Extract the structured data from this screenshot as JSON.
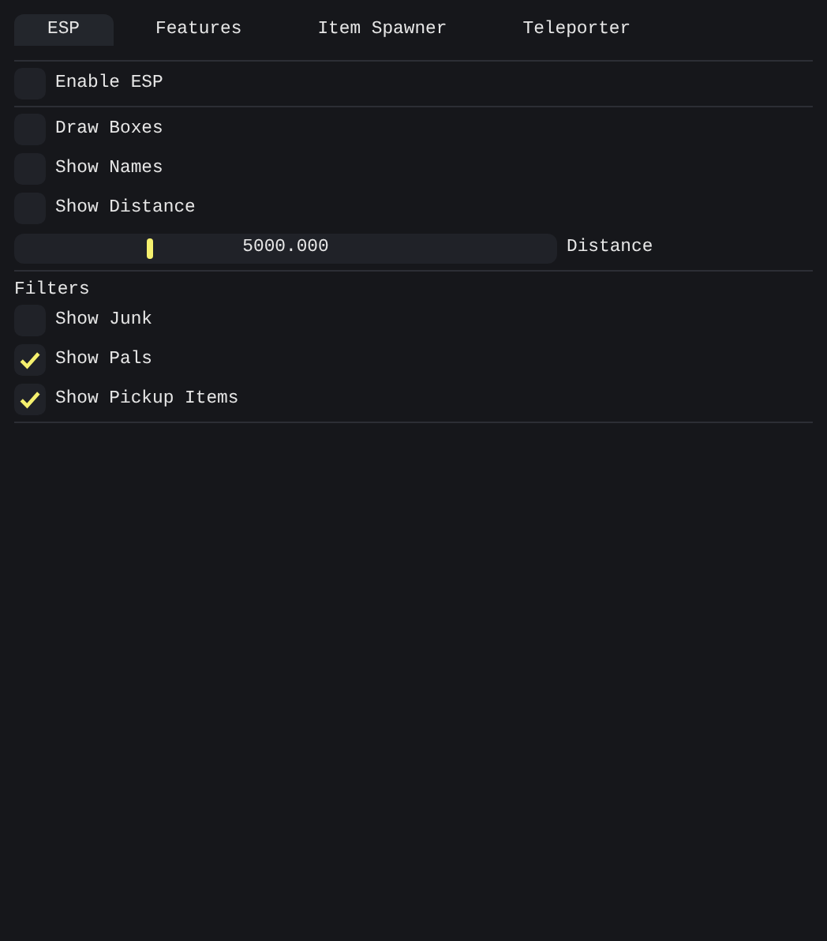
{
  "tabs": [
    {
      "label": "ESP",
      "selected": true
    },
    {
      "label": "Features",
      "selected": false
    },
    {
      "label": "Item Spawner",
      "selected": false
    },
    {
      "label": "Teleporter",
      "selected": false
    }
  ],
  "sections": [
    {
      "items": [
        {
          "kind": "checkbox",
          "label": "Enable ESP",
          "checked": false
        }
      ]
    },
    {
      "items": [
        {
          "kind": "checkbox",
          "label": "Draw Boxes",
          "checked": false
        },
        {
          "kind": "checkbox",
          "label": "Show Names",
          "checked": false
        },
        {
          "kind": "checkbox",
          "label": "Show Distance",
          "checked": false
        },
        {
          "kind": "slider",
          "value": "5000.000",
          "label": "Distance",
          "level": 0.25
        }
      ]
    },
    {
      "items": [
        {
          "kind": "heading",
          "label": "Filters"
        },
        {
          "kind": "checkbox",
          "label": "Show Junk",
          "checked": false
        },
        {
          "kind": "checkbox",
          "label": "Show Pals",
          "checked": true
        },
        {
          "kind": "checkbox",
          "label": "Show Pickup Items",
          "checked": true
        }
      ]
    }
  ]
}
